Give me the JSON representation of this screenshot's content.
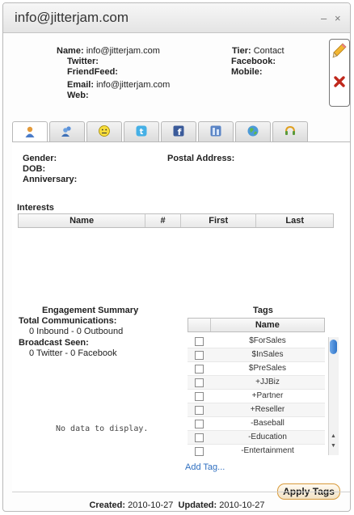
{
  "window": {
    "title": "info@jitterjam.com",
    "minimize": "–",
    "close": "×"
  },
  "contact": {
    "name_label": "Name:",
    "name_value": "info@jitterjam.com",
    "twitter_label": "Twitter:",
    "friendfeed_label": "FriendFeed:",
    "email_label": "Email:",
    "email_value": "info@jitterjam.com",
    "web_label": "Web:",
    "tier_label": "Tier:",
    "tier_value": "Contact",
    "facebook_label": "Facebook:",
    "mobile_label": "Mobile:"
  },
  "tabs": [
    {
      "icon": "person-icon",
      "active": true
    },
    {
      "icon": "people-icon"
    },
    {
      "icon": "smiley-icon"
    },
    {
      "icon": "twitter-icon"
    },
    {
      "icon": "facebook-icon"
    },
    {
      "icon": "friendfeed-icon"
    },
    {
      "icon": "globe-icon"
    },
    {
      "icon": "phone-icon"
    }
  ],
  "details": {
    "gender_label": "Gender:",
    "dob_label": "DOB:",
    "anniversary_label": "Anniversary:",
    "postal_label": "Postal Address:"
  },
  "interests": {
    "title": "Interests",
    "columns": [
      "Name",
      "#",
      "First",
      "Last"
    ]
  },
  "engagement": {
    "title": "Engagement Summary",
    "total_label": "Total Communications:",
    "total_value": "0 Inbound - 0 Outbound",
    "broadcast_label": "Broadcast Seen:",
    "broadcast_value": "0 Twitter - 0 Facebook",
    "empty": "No data to display."
  },
  "tags": {
    "title": "Tags",
    "column": "Name",
    "items": [
      "$ForSales",
      "$InSales",
      "$PreSales",
      "+JJBiz",
      "+Partner",
      "+Reseller",
      "-Baseball",
      "-Education",
      "-Entertainment"
    ],
    "add_label": "Add Tag...",
    "apply_label": "Apply Tags"
  },
  "footer": {
    "created_label": "Created:",
    "created_value": "2010-10-27",
    "updated_label": "Updated:",
    "updated_value": "2010-10-27"
  }
}
